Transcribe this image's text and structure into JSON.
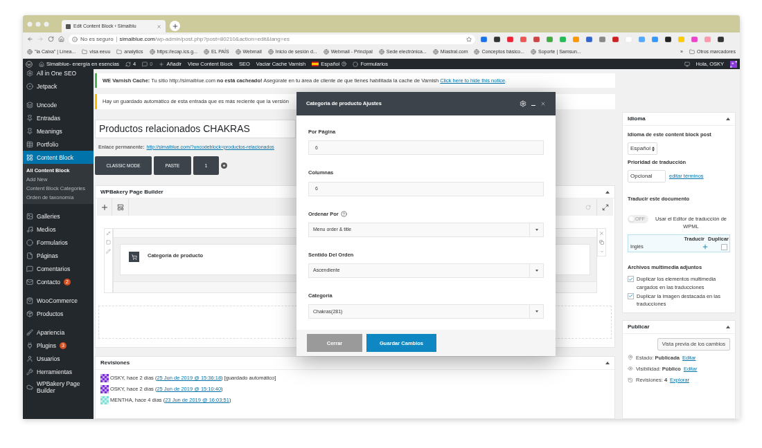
{
  "browser": {
    "tab_title": "Edit Content Block ‹ Simaiblu",
    "security": "No es seguro",
    "url_host": "simaiblue.com",
    "url_path": "/wp-admin/post.php?post=80210&action=edit&lang=es",
    "bookmarks": [
      {
        "label": "\"la Caixa\" | Línea...",
        "kind": "site"
      },
      {
        "label": "visa eeuu",
        "kind": "folder"
      },
      {
        "label": "analytics",
        "kind": "folder"
      },
      {
        "label": "https://ecap.ics.g...",
        "kind": "site"
      },
      {
        "label": "EL PAÍS",
        "kind": "site"
      },
      {
        "label": "Webmail",
        "kind": "site"
      },
      {
        "label": "Inicio de sesión d...",
        "kind": "site"
      },
      {
        "label": "Webmail - Principal",
        "kind": "site"
      },
      {
        "label": "Sede electrónica...",
        "kind": "site"
      },
      {
        "label": "Miastral.com",
        "kind": "site"
      },
      {
        "label": "Conceptos básico...",
        "kind": "site"
      },
      {
        "label": "Soporte | Samsun...",
        "kind": "site"
      }
    ],
    "more": "»",
    "other_bookmarks": "Otros marcadores"
  },
  "admin_bar": {
    "site": "Simaiblue- energía en esencias",
    "updates": "4",
    "comments": "0",
    "add": "Añadir",
    "items": [
      "View Content Block",
      "SEO",
      "Vaciar Cache Varnish"
    ],
    "language": "Español",
    "forms": "Formularios",
    "greeting": "Hola, OSKY"
  },
  "sidebar": {
    "sections": [
      {
        "items": [
          {
            "label": "All in One SEO",
            "selected": false
          },
          {
            "label": "Jetpack",
            "selected": false
          }
        ]
      },
      {
        "items": [
          {
            "label": "Uncode",
            "selected": false
          },
          {
            "label": "Entradas",
            "selected": false
          },
          {
            "label": "Meanings",
            "selected": false
          },
          {
            "label": "Portfolio",
            "selected": false
          },
          {
            "label": "Content Block",
            "selected": true,
            "children": [
              {
                "label": "All Content Block",
                "selected": true
              },
              {
                "label": "Add New",
                "selected": false
              },
              {
                "label": "Content Block Categories",
                "selected": false
              },
              {
                "label": "Orden de taxonomía",
                "selected": false
              }
            ]
          }
        ]
      },
      {
        "items": [
          {
            "label": "Galleries",
            "selected": false
          },
          {
            "label": "Medios",
            "selected": false
          },
          {
            "label": "Formularios",
            "selected": false
          },
          {
            "label": "Páginas",
            "selected": false
          },
          {
            "label": "Comentarios",
            "selected": false
          },
          {
            "label": "Contacto",
            "selected": false,
            "badge": "2"
          }
        ]
      },
      {
        "items": [
          {
            "label": "WooCommerce",
            "selected": false
          },
          {
            "label": "Productos",
            "selected": false
          }
        ]
      },
      {
        "items": [
          {
            "label": "Apariencia",
            "selected": false
          },
          {
            "label": "Plugins",
            "selected": false,
            "badge": "3"
          },
          {
            "label": "Usuarios",
            "selected": false
          },
          {
            "label": "Herramientas",
            "selected": false
          },
          {
            "label": "WPBakery Page Builder",
            "selected": false
          }
        ]
      }
    ]
  },
  "notices": [
    {
      "kind": "success",
      "text": "**WE Varnish Cache:** Tu sitio http://simaiblue.com **no está cacheado!** Asegúrate en tu área de cliente de que tienes habilitada la cache de Varnish ",
      "link": "Click here to hide this notice",
      "after": "."
    },
    {
      "kind": "warning",
      "text": "Hay un guardado automático de esta entrada que es más reciente que la versión"
    }
  ],
  "editor": {
    "title": "Productos relacionados CHAKRAS",
    "permalink_label": "Enlace permanente:",
    "permalink": "http://simaiblue.com/?uncodeblock=productos-relacionados",
    "buttons": [
      "CLASSIC MODE",
      "PASTE",
      "1"
    ]
  },
  "builder": {
    "title": "WPBakery Page Builder",
    "element": "Categoría de producto"
  },
  "revisions": {
    "title": "Revisiones",
    "rows": [
      {
        "prefix": "OSKY, hace 2 días (",
        "link": "25 Jun de 2019 @ 15:36:18",
        "suffix": ") [guardado automático]",
        "color": "#7a2fd8"
      },
      {
        "prefix": "OSKY, hace 2 días (",
        "link": "25 Jun de 2019 @ 15:10:40",
        "suffix": ")",
        "color": "#7a2fd8"
      },
      {
        "prefix": "MENTHA, hace 4 días (",
        "link": "23 Jun de 2019 @ 16:03:51",
        "suffix": ")",
        "color": "#7fe0d6"
      }
    ]
  },
  "language_box": {
    "title": "Idioma",
    "language_label": "Idioma de este content block post",
    "language": "Español",
    "priority_label": "Prioridad de traducción",
    "priority": "Opcional",
    "edit_terms": "editar términos",
    "translate_label": "Traducir este documento",
    "editor_toggle": {
      "on": false,
      "state_text": "OFF",
      "label": "Usar el Editor de traducción de WPML"
    },
    "table": {
      "columns": [
        "Traducir",
        "Duplicar"
      ],
      "rows": [
        {
          "language": "Inglés",
          "duplicate": false
        }
      ]
    },
    "media_label": "Archivos multimedia adjuntos",
    "media_options": [
      {
        "label": "Duplicar los elementos multimedia cargados en las traducciones",
        "checked": true
      },
      {
        "label": "Duplicar la imagen destacada en las traducciones",
        "checked": true
      }
    ]
  },
  "publish_box": {
    "title": "Publicar",
    "preview": "Vista previa de los cambios",
    "rows": [
      {
        "label": "Estado:",
        "value": "Publicada",
        "link": "Editar"
      },
      {
        "label": "Visibilidad:",
        "value": "Público",
        "link": "Editar"
      },
      {
        "label": "Revisiones:",
        "value": "4",
        "link": "Explorar"
      }
    ]
  },
  "modal": {
    "title": "Categoría de producto Ajustes",
    "fields": [
      {
        "kind": "text",
        "label": "Por Página",
        "value": "6",
        "help": false
      },
      {
        "kind": "text",
        "label": "Columnas",
        "value": "6",
        "help": false
      },
      {
        "kind": "select",
        "label": "Ordenar Por",
        "value": "Menu order & title",
        "help": true
      },
      {
        "kind": "select",
        "label": "Sentido Del Orden",
        "value": "Ascendiente",
        "help": false
      },
      {
        "kind": "select",
        "label": "Categoría",
        "value": "Chakras(281)",
        "help": false
      }
    ],
    "buttons": [
      {
        "label": "Cerrar",
        "kind": "secondary"
      },
      {
        "label": "Guardar Cambios",
        "kind": "primary"
      }
    ]
  }
}
